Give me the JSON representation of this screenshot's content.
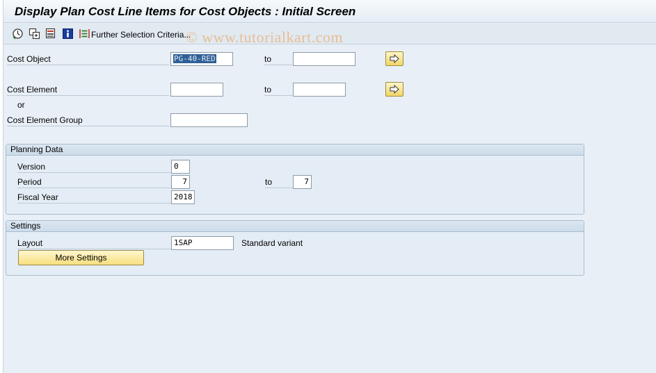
{
  "title": "Display Plan Cost Line Items for Cost Objects : Initial Screen",
  "toolbar": {
    "further_selection_label": "Further Selection Criteria..."
  },
  "watermark": "© www.tutorialkart.com",
  "selection": {
    "cost_object_label": "Cost Object",
    "cost_object_from": "PG-40-RED",
    "cost_object_to": "",
    "to_label": "to",
    "cost_element_label": "Cost Element",
    "cost_element_from": "",
    "cost_element_to": "",
    "or_label": "or",
    "cost_element_group_label": "Cost Element Group",
    "cost_element_group_value": ""
  },
  "planning": {
    "header": "Planning Data",
    "version_label": "Version",
    "version_value": "0",
    "period_label": "Period",
    "period_from": "7",
    "period_to_label": "to",
    "period_to": "7",
    "fiscal_year_label": "Fiscal Year",
    "fiscal_year_value": "2018"
  },
  "settings": {
    "header": "Settings",
    "layout_label": "Layout",
    "layout_value": "1SAP",
    "layout_description": "Standard variant",
    "more_settings_label": "More Settings"
  },
  "colors": {
    "background": "#e8eff6",
    "selected_text_bg": "#2f5f96",
    "button_yellow": "#f7de7e",
    "watermark": "#eb9b46"
  }
}
